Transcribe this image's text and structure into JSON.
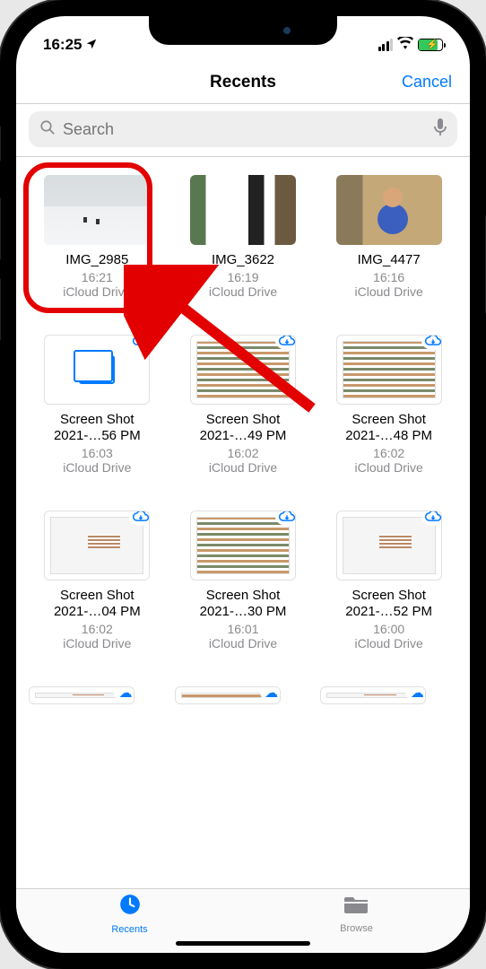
{
  "status": {
    "time": "16:25",
    "location_glyph": "➤"
  },
  "nav": {
    "title": "Recents",
    "cancel": "Cancel"
  },
  "search": {
    "placeholder": "Search"
  },
  "files": [
    {
      "name": "IMG_2985",
      "time": "16:21",
      "location": "iCloud Drive",
      "thumb": "snow",
      "cloud": false
    },
    {
      "name": "IMG_3622",
      "time": "16:19",
      "location": "iCloud Drive",
      "thumb": "dog",
      "cloud": false
    },
    {
      "name": "IMG_4477",
      "time": "16:16",
      "location": "iCloud Drive",
      "thumb": "person",
      "cloud": false
    },
    {
      "name": "Screen Shot 2021-…56 PM",
      "time": "16:03",
      "location": "iCloud Drive",
      "thumb": "generic",
      "cloud": true
    },
    {
      "name": "Screen Shot 2021-…49 PM",
      "time": "16:02",
      "location": "iCloud Drive",
      "thumb": "shot",
      "cloud": true
    },
    {
      "name": "Screen Shot 2021-…48 PM",
      "time": "16:02",
      "location": "iCloud Drive",
      "thumb": "shot",
      "cloud": true
    },
    {
      "name": "Screen Shot 2021-…04 PM",
      "time": "16:02",
      "location": "iCloud Drive",
      "thumb": "shot-light",
      "cloud": true
    },
    {
      "name": "Screen Shot 2021-…30 PM",
      "time": "16:01",
      "location": "iCloud Drive",
      "thumb": "shot",
      "cloud": true
    },
    {
      "name": "Screen Shot 2021-…52 PM",
      "time": "16:00",
      "location": "iCloud Drive",
      "thumb": "shot-light",
      "cloud": true
    }
  ],
  "tabs": {
    "recents": "Recents",
    "browse": "Browse"
  },
  "annotation": {
    "highlighted_file_index": 0
  }
}
